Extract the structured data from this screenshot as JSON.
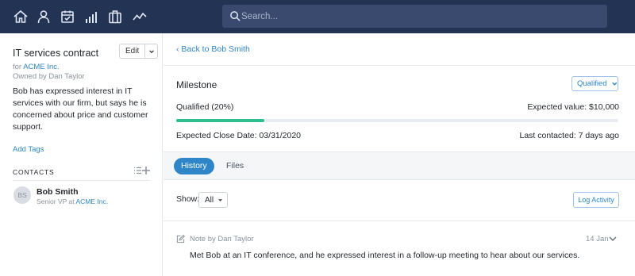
{
  "nav": {
    "icons": [
      "home-icon",
      "person-icon",
      "calendar-icon",
      "bar-chart-icon",
      "briefcase-icon",
      "activity-icon"
    ],
    "search_placeholder": "Search..."
  },
  "deal": {
    "title": "IT services contract",
    "edit_label": "Edit",
    "for_prefix": "for",
    "company": "ACME Inc.",
    "owned_by": "Owned by Dan Taylor",
    "description": "Bob has expressed interest in IT services with our firm, but says he is concerned about price and customer support.",
    "add_tags": "Add Tags"
  },
  "contacts": {
    "header": "CONTACTS",
    "items": [
      {
        "initials": "BS",
        "name": "Bob Smith",
        "title_prefix": "Senior VP at",
        "company": "ACME Inc."
      }
    ]
  },
  "main": {
    "back_link": "‹ Back to Bob Smith",
    "milestone_label": "Milestone",
    "stage_button": "Qualified",
    "stage_text": "Qualified (20%)",
    "progress": 0.2,
    "expected_value": "Expected value: $10,000",
    "close_date": "Expected Close Date: 03/31/2020",
    "last_contacted": "Last contacted: 7 days ago",
    "tabs": [
      {
        "label": "History",
        "active": true
      },
      {
        "label": "Files",
        "active": false
      }
    ],
    "show_label": "Show:",
    "show_value": "All",
    "log_activity": "Log Activity",
    "note": {
      "meta": "Note by Dan Taylor",
      "date": "14 Jan",
      "body": "Met Bob at an IT conference, and he expressed interest in a follow-up meeting to hear about our services."
    }
  },
  "colors": {
    "topbar": "#223354",
    "accent": "#2e86c9",
    "progress": "#2dbd8e"
  }
}
